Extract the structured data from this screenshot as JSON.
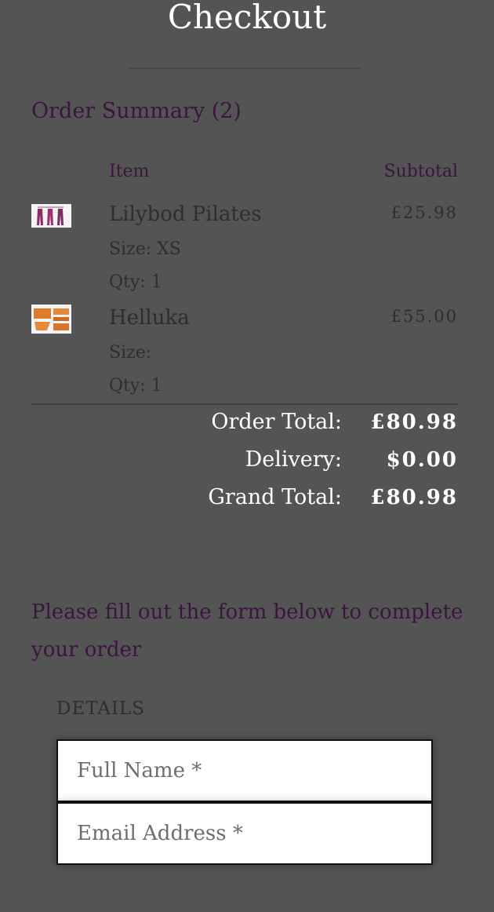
{
  "page": {
    "title": "Checkout"
  },
  "summary": {
    "heading": "Order Summary (2)",
    "col_item": "Item",
    "col_subtotal": "Subtotal",
    "items": [
      {
        "name": "Lilybod Pilates",
        "size": "Size: XS",
        "qty": "Qty: 1",
        "price": "£25.98",
        "thumb_icon": "leggings-product-icon"
      },
      {
        "name": "Helluka",
        "size": "Size:",
        "qty": "Qty: 1",
        "price": "£55.00",
        "thumb_icon": "orange-mat-product-icon"
      }
    ],
    "order_total_label": "Order Total:",
    "order_total_value": "£80.98",
    "delivery_label": "Delivery:",
    "delivery_value": "$0.00",
    "grand_total_label": "Grand Total:",
    "grand_total_value": "£80.98"
  },
  "form": {
    "intro": "Please fill out the form below to complete your order",
    "section_label": "DETAILS",
    "full_name": {
      "placeholder": "Full Name *",
      "value": ""
    },
    "email": {
      "placeholder": "Email Address *",
      "value": ""
    }
  },
  "colors": {
    "background": "#545454",
    "accent_text": "#3b1440",
    "heading": "#ffffff"
  }
}
